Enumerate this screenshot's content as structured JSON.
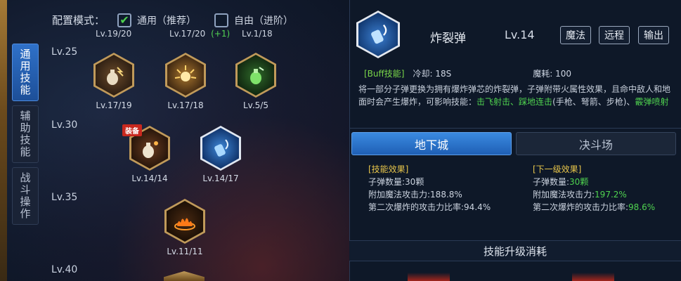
{
  "config": {
    "label": "配置模式：",
    "options": [
      {
        "label": "通用（推荐）",
        "checked": true
      },
      {
        "label": "自由（进阶）",
        "checked": false
      }
    ]
  },
  "side_tabs": [
    {
      "label": "通用技能",
      "active": true
    },
    {
      "label": "辅助技能",
      "active": false
    },
    {
      "label": "战斗操作",
      "active": false
    }
  ],
  "top_partial_levels": [
    "Lv.19/20",
    "Lv.17/20",
    "(+1)",
    "Lv.1/18"
  ],
  "levels": [
    "Lv.25",
    "Lv.30",
    "Lv.35",
    "Lv.40"
  ],
  "skills": [
    {
      "name": "grenade-hand",
      "level": "Lv.17/19",
      "icon": "hand-grenade-icon"
    },
    {
      "name": "burst-fire",
      "level": "Lv.17/18",
      "icon": "burst-icon"
    },
    {
      "name": "green-grenade",
      "level": "Lv.5/5",
      "icon": "green-grenade-icon"
    },
    {
      "name": "frag-equip",
      "level": "Lv.14/14",
      "icon": "frag-icon",
      "badge": "装备"
    },
    {
      "name": "blue-bottle",
      "level": "Lv.14/17",
      "icon": "blue-bottle-icon"
    },
    {
      "name": "fire-ring",
      "level": "Lv.11/11",
      "icon": "fire-ring-icon"
    }
  ],
  "detail": {
    "name": "炸裂弹",
    "level": "Lv.14",
    "tags": [
      "魔法",
      "远程",
      "输出"
    ],
    "buff_label": "[Buff技能]",
    "cooldown": "冷却: 18S",
    "mp_cost": "魔耗: 100",
    "description_plain": "将一部分子弹更换为拥有爆炸弹芯的炸裂弹，子弹附带火属性效果，且命中敌人和地面时会产生爆炸，可影响技能：",
    "affected_1": "击飞射击",
    "sep_1": "、",
    "affected_2": "踩地连击",
    "description_tail": "(手枪、弩箭、步枪)、",
    "affected_3": "霰弹喷射"
  },
  "mode_tabs": [
    {
      "label": "地下城",
      "active": true
    },
    {
      "label": "决斗场",
      "active": false
    }
  ],
  "effects": {
    "current": {
      "title": "[技能效果]",
      "lines": [
        {
          "label": "子弹数量:",
          "value": "30颗"
        },
        {
          "label": "附加魔法攻击力:",
          "value": "188.8%"
        },
        {
          "label": "第二次爆炸的攻击力比率:",
          "value": "94.4%"
        }
      ]
    },
    "next": {
      "title": "[下一级效果]",
      "lines": [
        {
          "label": "子弹数量:",
          "value": "30颗"
        },
        {
          "label": "附加魔法攻击力:",
          "value": "197.2%"
        },
        {
          "label": "第二次爆炸的攻击力比率:",
          "value": "98.6%"
        }
      ]
    }
  },
  "upgrade_title": "技能升级消耗",
  "colors": {
    "accent": "#2f71c9",
    "green": "#4fd24f",
    "gold": "#e6c44a"
  }
}
